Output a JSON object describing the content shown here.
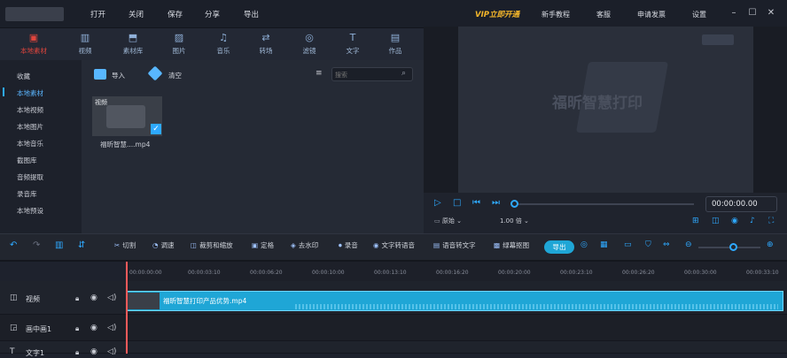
{
  "title_menu": [
    "打开",
    "关闭",
    "保存",
    "分享",
    "导出"
  ],
  "vip_label": "VIP立即开通",
  "title_right": [
    "新手教程",
    "客服",
    "申请发票",
    "设置"
  ],
  "media_tabs": [
    {
      "label": "本地素材",
      "icon": "folder-icon",
      "active": true
    },
    {
      "label": "视频",
      "icon": "film-icon"
    },
    {
      "label": "素材库",
      "icon": "library-icon"
    },
    {
      "label": "图片",
      "icon": "image-icon"
    },
    {
      "label": "音乐",
      "icon": "music-icon"
    },
    {
      "label": "转场",
      "icon": "transition-icon"
    },
    {
      "label": "滤镜",
      "icon": "filter-icon"
    },
    {
      "label": "文字",
      "icon": "text-icon"
    },
    {
      "label": "作品",
      "icon": "works-icon"
    }
  ],
  "sidebar": {
    "items": [
      "收藏",
      "本地素材",
      "本地视频",
      "本地图片",
      "本地音乐",
      "截图库",
      "音频提取",
      "录音库",
      "本地预设"
    ],
    "selected": "本地素材"
  },
  "library": {
    "import_label": "导入",
    "clear_label": "清空",
    "search_placeholder": "搜索",
    "file": {
      "badge": "视频",
      "name": "福昕智慧....mp4",
      "checked": true
    }
  },
  "preview": {
    "watermark": "福昕智慧打印",
    "time": "00:00:00.00",
    "ratio": "原始",
    "speed": "1.00 倍"
  },
  "edit_tools": [
    "切割",
    "调速",
    "裁剪和缩放",
    "定格",
    "去水印",
    "录音",
    "文字转语音",
    "语音转文字",
    "绿幕抠图"
  ],
  "export_label": "导出",
  "ruler_ticks": [
    "00:00:00:00",
    "00:00:03:10",
    "00:00:06:20",
    "00:00:10:00",
    "00:00:13:10",
    "00:00:16:20",
    "00:00:20:00",
    "00:00:23:10",
    "00:00:26:20",
    "00:00:30:00",
    "00:00:33:10"
  ],
  "tracks": [
    {
      "name": "视频"
    },
    {
      "name": "画中画1"
    },
    {
      "name": "文字1"
    }
  ],
  "clip_name": "福昕智慧打印产品优势.mp4",
  "colors": {
    "accent": "#e0453d",
    "clip": "#1fa6d6",
    "vip": "#f5b72a",
    "export": "#1fa6d6"
  }
}
